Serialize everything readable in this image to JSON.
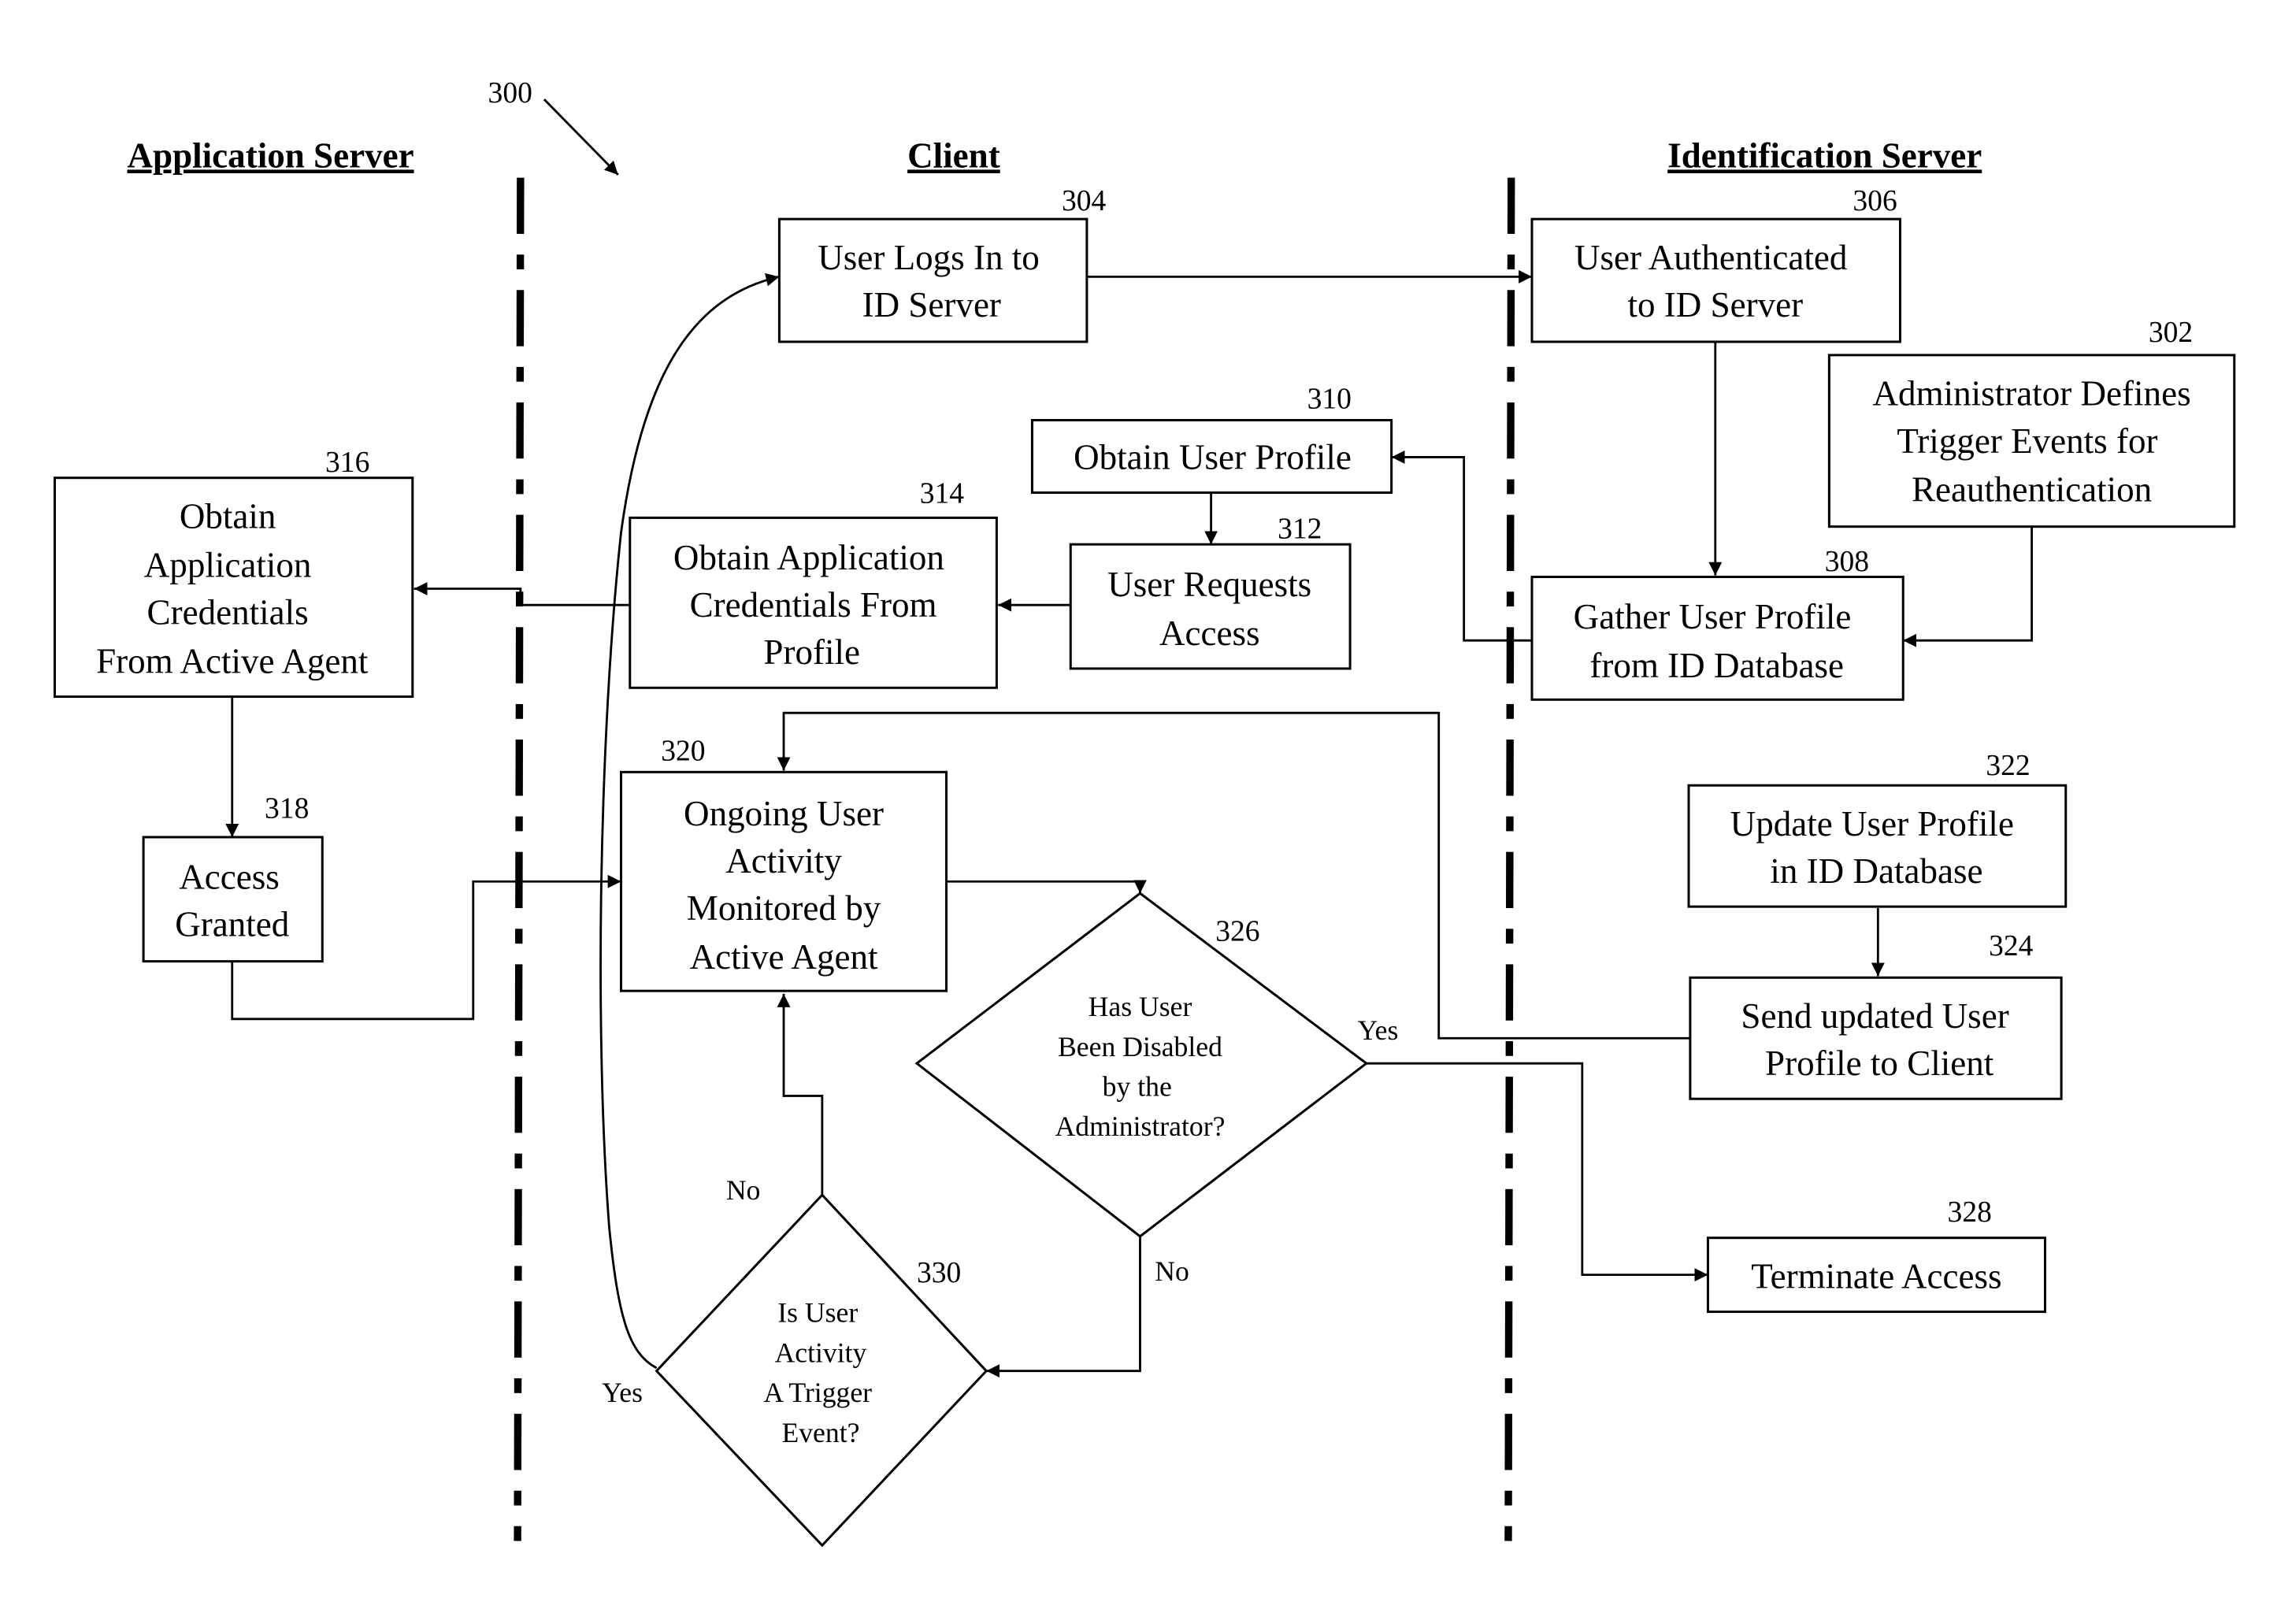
{
  "figure": {
    "ref": "300",
    "lanes": [
      "Application Server",
      "Client",
      "Identification Server"
    ]
  },
  "nodes": {
    "n304": {
      "ref": "304",
      "lines": [
        "User Logs In to",
        "ID Server"
      ]
    },
    "n306": {
      "ref": "306",
      "lines": [
        "User Authenticated",
        "to ID Server"
      ]
    },
    "n302": {
      "ref": "302",
      "lines": [
        "Administrator Defines",
        "Trigger Events for",
        "Reauthentication"
      ]
    },
    "n310": {
      "ref": "310",
      "lines": [
        "Obtain User Profile"
      ]
    },
    "n312": {
      "ref": "312",
      "lines": [
        "User Requests",
        "Access"
      ]
    },
    "n308": {
      "ref": "308",
      "lines": [
        "Gather User Profile",
        "from ID Database"
      ]
    },
    "n314": {
      "ref": "314",
      "lines": [
        "Obtain Application",
        "Credentials From",
        "Profile"
      ]
    },
    "n316": {
      "ref": "316",
      "lines": [
        "Obtain",
        "Application",
        "Credentials",
        "From Active Agent"
      ]
    },
    "n318": {
      "ref": "318",
      "lines": [
        "Access",
        "Granted"
      ]
    },
    "n320": {
      "ref": "320",
      "lines": [
        "Ongoing User",
        "Activity",
        "Monitored by",
        "Active Agent"
      ]
    },
    "n322": {
      "ref": "322",
      "lines": [
        "Update User Profile",
        "in ID Database"
      ]
    },
    "n324": {
      "ref": "324",
      "lines": [
        "Send updated User",
        "Profile to Client"
      ]
    },
    "n326": {
      "ref": "326",
      "lines": [
        "Has User",
        "Been Disabled",
        "by the",
        "Administrator?"
      ]
    },
    "n328": {
      "ref": "328",
      "lines": [
        "Terminate Access"
      ]
    },
    "n330": {
      "ref": "330",
      "lines": [
        "Is User",
        "Activity",
        "A Trigger",
        "Event?"
      ]
    }
  },
  "edge_labels": {
    "yes_326": "Yes",
    "no_326": "No",
    "yes_330": "Yes",
    "no_330": "No"
  }
}
